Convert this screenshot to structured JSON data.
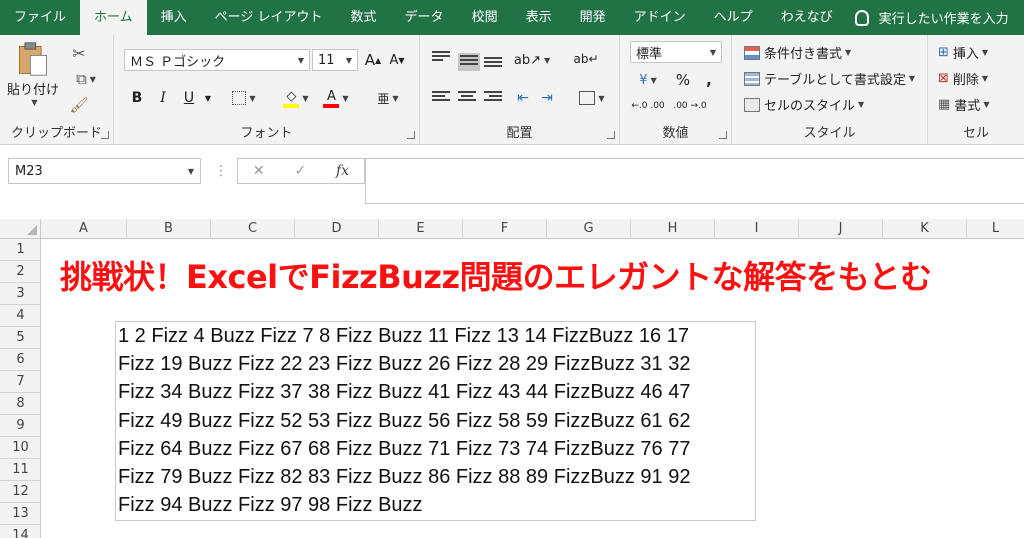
{
  "menu": {
    "tabs": [
      "ファイル",
      "ホーム",
      "挿入",
      "ページ レイアウト",
      "数式",
      "データ",
      "校閲",
      "表示",
      "開発",
      "アドイン",
      "ヘルプ",
      "わえなび"
    ],
    "active_index": 1,
    "tell_me": "実行したい作業を入力"
  },
  "ribbon": {
    "clipboard": {
      "label": "クリップボード",
      "paste": "貼り付け"
    },
    "font": {
      "label": "フォント",
      "name": "ＭＳ Ｐゴシック",
      "size": "11",
      "bold": "B",
      "italic": "I",
      "underline": "U",
      "grow": "A",
      "shrink": "A"
    },
    "alignment": {
      "label": "配置"
    },
    "number": {
      "label": "数値",
      "format": "標準",
      "percent": "%",
      "comma": ",",
      "inc_decimal": "←.0 .00",
      "dec_decimal": ".00 →.0"
    },
    "styles": {
      "label": "スタイル",
      "conditional": "条件付き書式",
      "table": "テーブルとして書式設定",
      "cell_styles": "セルのスタイル"
    },
    "cells": {
      "label": "セル",
      "insert": "挿入",
      "delete": "削除",
      "format": "書式"
    }
  },
  "formula_bar": {
    "name_box": "M23",
    "cancel": "✕",
    "enter": "✓",
    "fx": "fx",
    "value": ""
  },
  "grid": {
    "columns": [
      "A",
      "B",
      "C",
      "D",
      "E",
      "F",
      "G",
      "H",
      "I",
      "J",
      "K",
      "L"
    ],
    "rows": [
      "1",
      "2",
      "3",
      "4",
      "5",
      "6",
      "7",
      "8",
      "9",
      "10",
      "11",
      "12",
      "13",
      "14"
    ]
  },
  "content": {
    "title": "挑戦状！ExcelでFizzBuzz問題のエレガントな解答をもとむ",
    "fizzbuzz_lines": [
      "1 2 Fizz 4 Buzz Fizz 7 8 Fizz Buzz 11 Fizz 13 14 FizzBuzz 16 17",
      "Fizz 19 Buzz Fizz 22 23 Fizz Buzz 26 Fizz 28 29 FizzBuzz 31 32",
      "Fizz 34 Buzz Fizz 37 38 Fizz Buzz 41 Fizz 43 44 FizzBuzz 46 47",
      "Fizz 49 Buzz Fizz 52 53 Fizz Buzz 56 Fizz 58 59 FizzBuzz 61 62",
      "Fizz 64 Buzz Fizz 67 68 Fizz Buzz 71 Fizz 73 74 FizzBuzz 76 77",
      "Fizz 79 Buzz Fizz 82 83 Fizz Buzz 86 Fizz 88 89 FizzBuzz 91 92",
      "Fizz 94 Buzz Fizz 97 98 Fizz Buzz"
    ]
  },
  "colors": {
    "excel_green": "#217346",
    "title_red": "#ff1010",
    "ribbon_bg": "#f3f3f3"
  }
}
